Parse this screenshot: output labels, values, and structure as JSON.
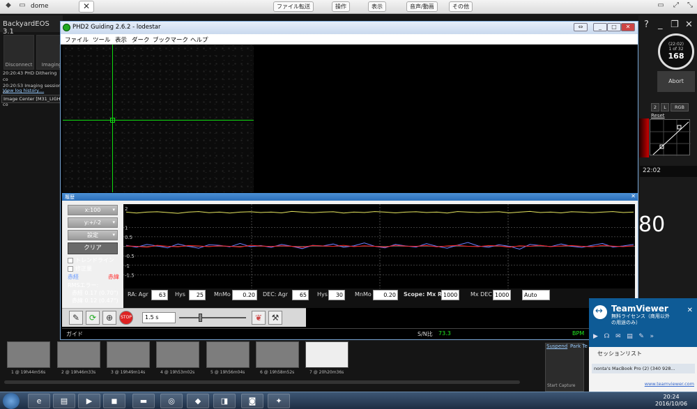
{
  "topbar": {
    "title": "dome",
    "close_label": "✕",
    "buttons": [
      "ファイル転送",
      "操作",
      "表示",
      "音声/動画",
      "その他"
    ]
  },
  "backyard": {
    "title": "BackyardEOS 3.1",
    "tiles": [
      "Disconnect",
      "Imaging"
    ],
    "log_lines": [
      "20:20:43  PHD Dithering co",
      "20:20:53  Imaging session co",
      "20:21:11  Imaging session co"
    ],
    "view_log": "View log history....",
    "image_center": "Image Center [M31_LIGH",
    "counter_time": "(22:02)",
    "counter_of": "1 of 32",
    "counter_value": "168",
    "abort": "Abort",
    "hist_buttons": [
      "2",
      "L",
      "RGB"
    ],
    "reset": "Reset",
    "timestamp": "22:02",
    "big_number": "80",
    "suspend": "Suspend",
    "park": "Park Te",
    "start_capture": "Start Capture",
    "thumbs": [
      "1 @ 19h44m56s",
      "2 @ 19h46m33s",
      "3 @ 19h49m14s",
      "4 @ 19h53m02s",
      "5 @ 19h56m04s",
      "6 @ 19h58m52s",
      "7 @ 20h20m36s"
    ]
  },
  "phd": {
    "title": "PHD2 Guiding 2.6.2 - lodestar",
    "menu": [
      "ファイル",
      "ツール",
      "表示",
      "ダーク",
      "ブックマーク",
      "ヘルプ"
    ],
    "history_title": "履歴",
    "x_scale": "x:100",
    "y_scale": "y:+/-2",
    "settings": "設定",
    "clear": "クリア",
    "trendline": "トレンドライン",
    "correction": "修正量",
    "ra_label": "赤経",
    "dec_label": "赤緯",
    "rms_title": "RMSエラー:",
    "rms_ra": "赤経 0.17 (0.70\")",
    "rms_dec": "赤緯 0.12 (0.47\")",
    "y_ticks": [
      "2",
      "1",
      "0.5",
      "-0.5",
      "-1",
      "-1.5"
    ],
    "params": {
      "ra_agr_label": "RA: Agr",
      "ra_agr": "63",
      "ra_hys_label": "Hys",
      "ra_hys": "25",
      "ra_mnmo_label": "MnMo",
      "ra_mnmo": "0.20",
      "dec_agr_label": "DEC: Agr",
      "dec_agr": "65",
      "dec_hys_label": "Hys",
      "dec_hys": "30",
      "dec_mnmo_label": "MnMo",
      "dec_mnmo": "0.20",
      "scope_label": "Scope: Mx RA",
      "mx_ra": "1000",
      "mx_dec_label": "Mx DEC",
      "mx_dec": "1000",
      "mode": "Auto"
    },
    "exposure": "1.5 s",
    "status_left": "ガイド",
    "sn_label": "S/N比",
    "sn_value": "73.3",
    "bpm": "BPM"
  },
  "teamviewer": {
    "name": "TeamViewer",
    "sub1": "無料ライセンス（商用以外",
    "sub2": "の用途のみ）",
    "session_header": "セッションリスト",
    "session_item": "nonta's MacBook Pro (2) (340 928...",
    "url": "www.teamviewer.com"
  },
  "taskbar": {
    "time": "20:24",
    "date": "2016/10/06"
  },
  "chart_data": {
    "type": "line",
    "title": "",
    "ylim": [
      -2,
      2
    ],
    "series": [
      {
        "name": "赤経",
        "color": "#6b7dff",
        "values": [
          0.05,
          -0.05,
          0.1,
          0.02,
          -0.08,
          0.12,
          0.0,
          -0.1,
          0.08,
          0.05,
          -0.03,
          0.15,
          -0.02,
          0.04,
          -0.06,
          0.1,
          0.0,
          -0.12,
          0.05,
          0.02,
          0.12,
          -0.05,
          0.03,
          0.18,
          0.0,
          -0.08,
          0.1,
          0.02,
          -0.04,
          0.14,
          0.0,
          -0.1,
          0.06,
          0.2,
          0.02,
          -0.05,
          0.08,
          0.0,
          -0.15,
          0.1,
          0.04,
          -0.02,
          0.12,
          0.0,
          -0.06,
          0.05,
          0.15,
          -0.04,
          0.02,
          0.1
        ]
      },
      {
        "name": "赤緯",
        "color": "#ff2020",
        "values": [
          0.02,
          0.0,
          -0.05,
          0.05,
          0.0,
          -0.03,
          0.04,
          0.02,
          -0.02,
          0.03,
          0.0,
          -0.04,
          0.05,
          0.02,
          -0.01,
          0.03,
          0.0,
          -0.05,
          0.04,
          0.02,
          0.0,
          0.05,
          -0.02,
          0.03,
          0.0,
          -0.04,
          0.05,
          0.01,
          0.0,
          0.04,
          -0.03,
          0.02,
          0.05,
          0.0,
          -0.02,
          0.04,
          0.02,
          -0.05,
          0.03,
          0.0,
          0.05,
          -0.02,
          0.02,
          0.04,
          0.0,
          -0.03,
          0.05,
          0.01,
          -0.02,
          0.03
        ]
      },
      {
        "name": "",
        "color": "#e8e860",
        "values": [
          1.8,
          1.75,
          1.8,
          1.82,
          1.78,
          1.74,
          1.8,
          1.83,
          1.77,
          1.8,
          1.75,
          1.8,
          1.82,
          1.78,
          1.8,
          1.76,
          1.84,
          1.8,
          1.77,
          1.8,
          1.82,
          1.75,
          1.8,
          1.78,
          1.83,
          1.8,
          1.76,
          1.8,
          1.82,
          1.78,
          1.8,
          1.75,
          1.83,
          1.8,
          1.78,
          1.8,
          1.82,
          1.76,
          1.8,
          1.84,
          1.78,
          1.8,
          1.76,
          1.82,
          1.8,
          1.77,
          1.8,
          1.83,
          1.78,
          1.8
        ]
      }
    ]
  }
}
